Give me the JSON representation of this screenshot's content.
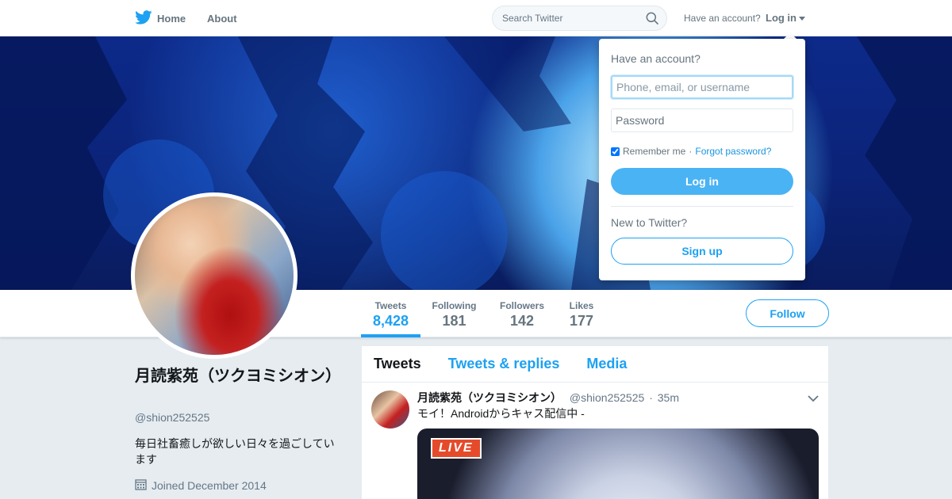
{
  "nav": {
    "home_label": "Home",
    "about_label": "About",
    "search_placeholder": "Search Twitter",
    "have_account": "Have an account?",
    "login_label": "Log in"
  },
  "profile": {
    "name": "月読紫苑（ツクヨミシオン）",
    "handle": "@shion252525",
    "bio": "毎日社畜癒しが欲しい日々を過ごしています",
    "joined": "Joined December 2014",
    "follow_label": "Follow",
    "stats": [
      {
        "label": "Tweets",
        "value": "8,428"
      },
      {
        "label": "Following",
        "value": "181"
      },
      {
        "label": "Followers",
        "value": "142"
      },
      {
        "label": "Likes",
        "value": "177"
      }
    ]
  },
  "timeline": {
    "tabs": [
      "Tweets",
      "Tweets & replies",
      "Media"
    ],
    "tweet": {
      "name": "月読紫苑（ツクヨミシオン）",
      "handle": "@shion252525",
      "separator": "·",
      "time": "35m",
      "text": "モイ！Androidからキャス配信中 -",
      "badge": "LIVE"
    }
  },
  "login_dropdown": {
    "title": "Have an account?",
    "username_placeholder": "Phone, email, or username",
    "password_placeholder": "Password",
    "remember_label": "Remember me",
    "separator": "·",
    "forgot_label": "Forgot password?",
    "login_button": "Log in",
    "new_label": "New to Twitter?",
    "signup_button": "Sign up"
  },
  "colors": {
    "accent": "#1da1f2",
    "login_button": "#4ab3f4",
    "live_badge": "#e54b2b"
  },
  "icons": [
    "twitter-bird-icon",
    "search-icon",
    "caret-down-icon",
    "calendar-icon",
    "chevron-down-icon"
  ]
}
